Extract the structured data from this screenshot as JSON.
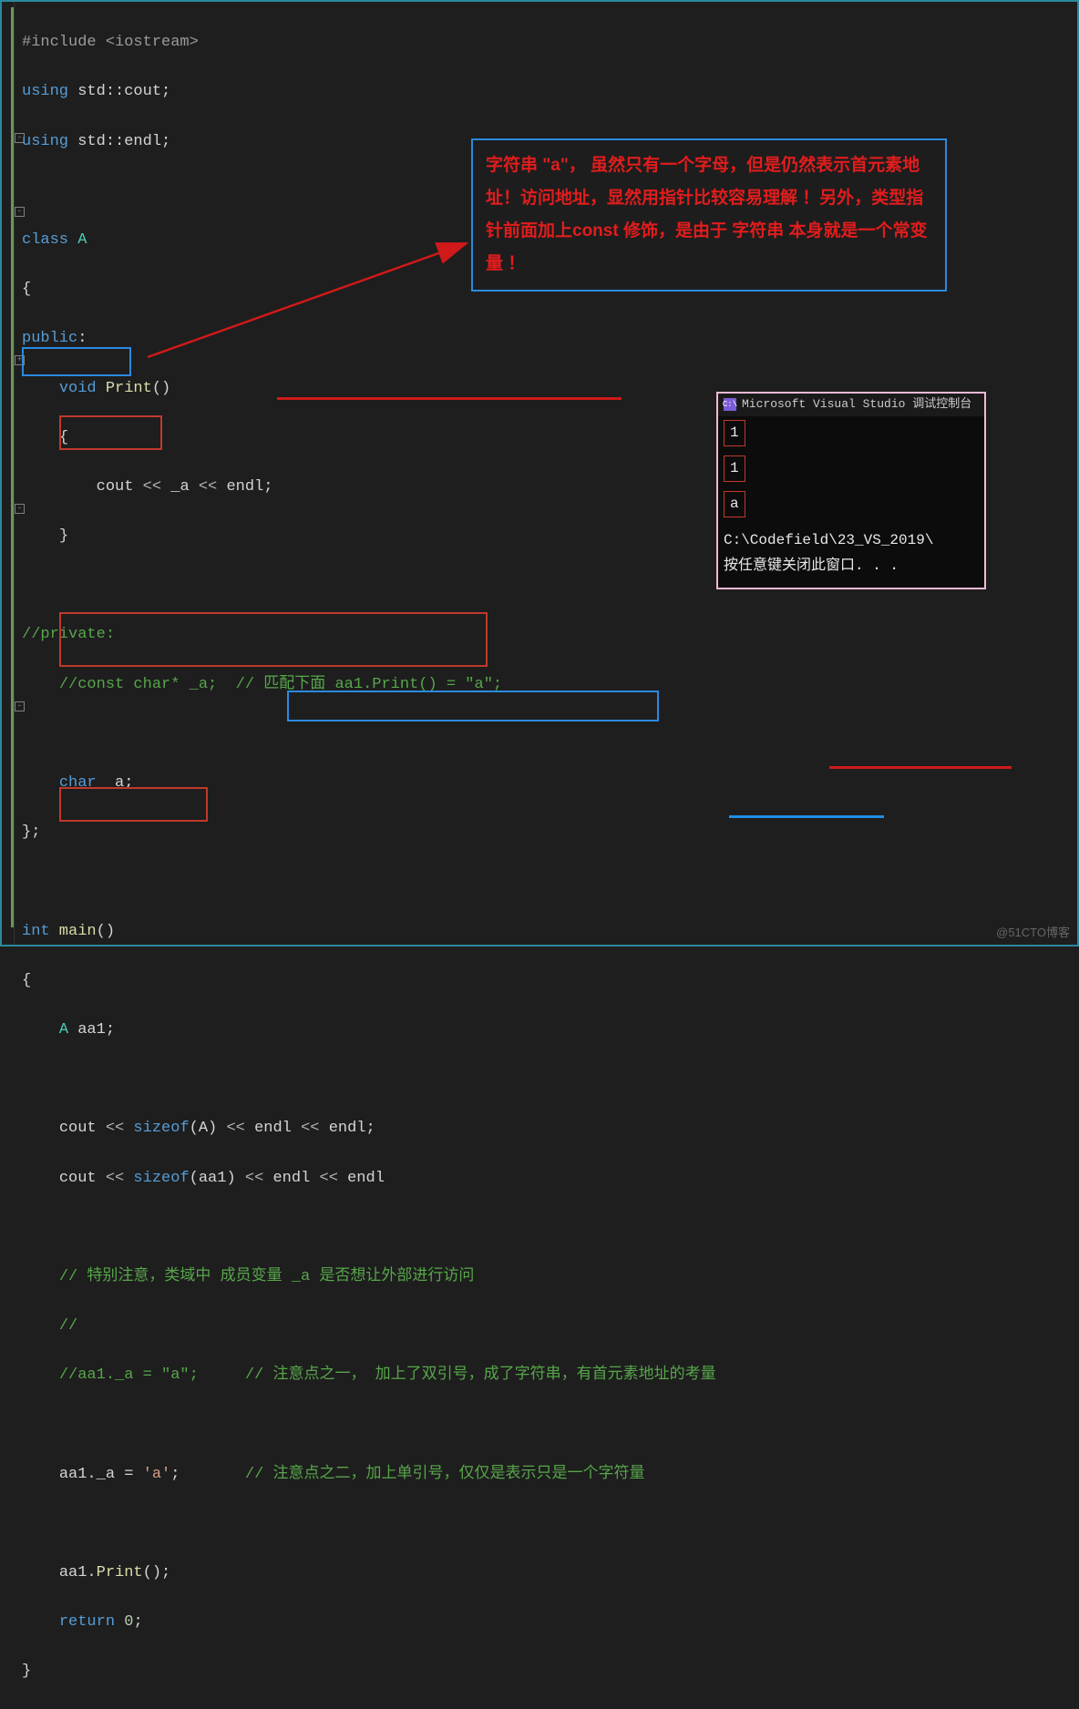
{
  "code": {
    "l1": "#include <iostream>",
    "l2_a": "using",
    "l2_b": " std::cout;",
    "l3_a": "using",
    "l3_b": " std::endl;",
    "l5_a": "class",
    "l5_b": " A",
    "l6": "{",
    "l7_a": "public",
    "l7_b": ":",
    "l8_a": "void",
    "l8_b": " Print",
    "l8_c": "()",
    "l9": "{",
    "l10_a": "cout ",
    "l10_b": "<<",
    "l10_c": " _a ",
    "l10_d": "<<",
    "l10_e": " endl;",
    "l11": "}",
    "l13": "//private:",
    "l14_a": "//const char* _a;  ",
    "l14_b": "// 匹配下面 aa1.Print() = \"a\";",
    "l16_a": "char",
    "l16_b": " _a;",
    "l17": "};",
    "l19_a": "int",
    "l19_b": " main",
    "l19_c": "()",
    "l20": "{",
    "l21_a": "A",
    "l21_b": " aa1;",
    "l23_a": "cout ",
    "l23_b": "<<",
    "l23_c": " sizeof",
    "l23_d": "(A) ",
    "l23_e": "<<",
    "l23_f": " endl ",
    "l23_g": "<<",
    "l23_h": " endl;",
    "l24_a": "cout ",
    "l24_b": "<<",
    "l24_c": " sizeof",
    "l24_d": "(aa1) ",
    "l24_e": "<<",
    "l24_f": " endl ",
    "l24_g": "<<",
    "l24_h": " endl",
    "l26_a": "// 特别注意，类域中 ",
    "l26_b": "成员变量 _a 是否想让外部进行访问",
    "l27": "//",
    "l28_a": "//aa1._a = \"a\";",
    "l28_b": "// 注意点之一， 加上了双引号，成了字符串，",
    "l28_c": "有首元素地址的考量",
    "l30_a": "aa1._a = ",
    "l30_b": "'a'",
    "l30_c": ";",
    "l30_d": "// 注意点之二，加上单引号，仅仅是表示",
    "l30_e": "只是一个字符量",
    "l32_a": "aa1.",
    "l32_b": "Print",
    "l32_c": "();",
    "l33_a": "return",
    "l33_b": " 0",
    "l33_c": ";",
    "l34": "}"
  },
  "annotation": {
    "text": "字符串 \"a\"， 虽然只有一个字母，但是仍然表示首元素地址！访问地址，显然用指针比较容易理解 ！另外，类型指针前面加上const 修饰，是由于 字符串 本身就是一个常变量 ！"
  },
  "console": {
    "title": "Microsoft Visual Studio 调试控制台",
    "out1": "1",
    "out2": "1",
    "out3": "a",
    "path": "C:\\Codefield\\23_VS_2019\\",
    "closeMsg": "按任意键关闭此窗口. . ."
  },
  "watermark": "@51CTO博客"
}
